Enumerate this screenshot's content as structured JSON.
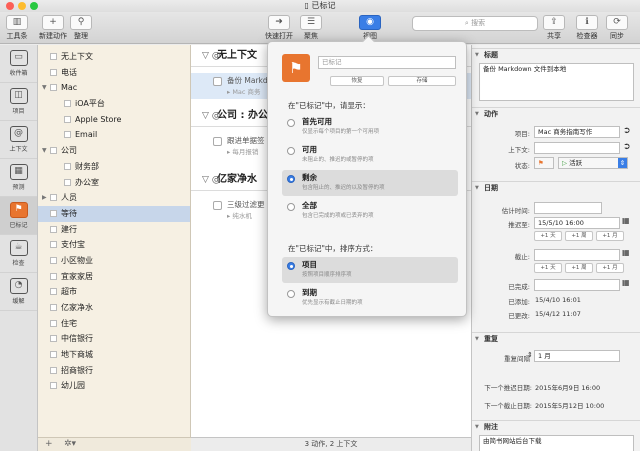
{
  "window": {
    "title": "已标记"
  },
  "toolbar": {
    "left": [
      {
        "label": "工具条",
        "icon": "sidebar-toggle-icon",
        "glyph": "▥"
      },
      {
        "label": "新建动作",
        "icon": "plus-icon",
        "glyph": "+"
      },
      {
        "label": "整理",
        "icon": "broom-icon",
        "glyph": "⚲"
      }
    ],
    "center": [
      {
        "label": "快速打开",
        "icon": "arrow-right-icon",
        "glyph": "➜"
      },
      {
        "label": "聚焦",
        "icon": "list-icon",
        "glyph": "☰"
      },
      {
        "label": "视图",
        "icon": "eye-icon",
        "glyph": "◉"
      }
    ],
    "search_placeholder": "搜索",
    "right": [
      {
        "label": "共享",
        "icon": "share-icon",
        "glyph": "⇪"
      },
      {
        "label": "检查器",
        "icon": "info-icon",
        "glyph": "ℹ"
      },
      {
        "label": "同步",
        "icon": "sync-icon",
        "glyph": "⟳"
      }
    ]
  },
  "perspectives": [
    {
      "label": "收件箱",
      "icon": "inbox-icon",
      "glyph": "▭"
    },
    {
      "label": "项目",
      "icon": "projects-icon",
      "glyph": "◫"
    },
    {
      "label": "上下文",
      "icon": "at-icon",
      "glyph": "@"
    },
    {
      "label": "预测",
      "icon": "forecast-icon",
      "glyph": "▦"
    },
    {
      "label": "已标记",
      "icon": "flag-icon",
      "glyph": "⚑",
      "selected": true
    },
    {
      "label": "检查",
      "icon": "coffee-icon",
      "glyph": "☕"
    },
    {
      "label": "缓解",
      "icon": "clock-icon",
      "glyph": "◔"
    }
  ],
  "contexts": [
    {
      "label": "无上下文",
      "indent": 0
    },
    {
      "label": "电话",
      "indent": 0
    },
    {
      "label": "Mac",
      "indent": 0,
      "expanded": true
    },
    {
      "label": "iOA平台",
      "indent": 1
    },
    {
      "label": "Apple Store",
      "indent": 1
    },
    {
      "label": "Email",
      "indent": 1
    },
    {
      "label": "公司",
      "indent": 0,
      "expanded": true
    },
    {
      "label": "财务部",
      "indent": 1
    },
    {
      "label": "办公室",
      "indent": 1
    },
    {
      "label": "人员",
      "indent": 0,
      "expanded": false
    },
    {
      "label": "等待",
      "indent": 0,
      "selected": true
    },
    {
      "label": "建行",
      "indent": 0
    },
    {
      "label": "支付宝",
      "indent": 0
    },
    {
      "label": "小区物业",
      "indent": 0
    },
    {
      "label": "宜家家居",
      "indent": 0
    },
    {
      "label": "超市",
      "indent": 0
    },
    {
      "label": "亿家净水",
      "indent": 0
    },
    {
      "label": "住宅",
      "indent": 0
    },
    {
      "label": "中信银行",
      "indent": 0
    },
    {
      "label": "地下商城",
      "indent": 0
    },
    {
      "label": "招商银行",
      "indent": 0
    },
    {
      "label": "幼儿园",
      "indent": 0
    }
  ],
  "main": {
    "groups": [
      {
        "title": "无上下文",
        "tasks": [
          {
            "title": "备份 Markdo",
            "sub": "▸ Mac 商务",
            "selected": true
          }
        ]
      },
      {
        "title": "公司 : 办公",
        "tasks": [
          {
            "title": "跟进单据签",
            "sub": "▸ 每月报销"
          }
        ]
      },
      {
        "title": "亿家净水",
        "tasks": [
          {
            "title": "三级过滤更",
            "sub": "▸ 纯水机"
          }
        ]
      }
    ],
    "status": "3 动作, 2 上下文"
  },
  "popover": {
    "field_placeholder": "已标记",
    "btn_restore": "恢复",
    "btn_save": "存储",
    "show_heading": "在\"已标记\"中，请显示：",
    "show_options": [
      {
        "label": "首先可用",
        "desc": "仅显示每个项目的第一个可用项"
      },
      {
        "label": "可用",
        "desc": "未阻止的、推迟的或暂停的项"
      },
      {
        "label": "剩余",
        "desc": "包含阻止的、推迟的以及暂停的项",
        "selected": true
      },
      {
        "label": "全部",
        "desc": "包含已完成的项或已丢弃的项"
      }
    ],
    "sort_heading": "在\"已标记\"中，排序方式：",
    "sort_options": [
      {
        "label": "项目",
        "desc": "按照项目顺序排序项",
        "selected": true
      },
      {
        "label": "到期",
        "desc": "优先显示有截止日期的项"
      }
    ]
  },
  "inspector": {
    "title_section": "标题",
    "title_value": "备份 Markdown 文件到本地",
    "action_section": "动作",
    "project_label": "项目:",
    "project_value": "Mac 商务指南写作",
    "context_label": "上下文:",
    "context_value": "",
    "status_label": "状态:",
    "status_value": "活跃",
    "dates_section": "日期",
    "estimate_label": "估计时间:",
    "estimate_value": "",
    "defer_label": "推迟至:",
    "defer_value": "15/5/10 16:00",
    "step_buttons": [
      "+1 天",
      "+1 周",
      "+1 月"
    ],
    "due_label": "截止:",
    "due_value": "",
    "completed_label": "已完成:",
    "completed_value": "",
    "added_label": "已添加:",
    "added_value": "15/4/10 16:01",
    "changed_label": "已更改:",
    "changed_value": "15/4/12 11:07",
    "repeat_section": "重复",
    "repeat_label": "重复间隔",
    "repeat_value": "1 月",
    "next_defer_label": "下一个推迟日期:",
    "next_defer_value": "2015年6月9日 16:00",
    "next_due_label": "下一个截止日期:",
    "next_due_value": "2015年5月12日 10:00",
    "note_section": "附注",
    "note_value": "由简书网站后台下载"
  },
  "colors": {
    "accent": "#3a7ee6",
    "flag": "#e8752f",
    "sidebar_bg": "#f6f0e3"
  }
}
